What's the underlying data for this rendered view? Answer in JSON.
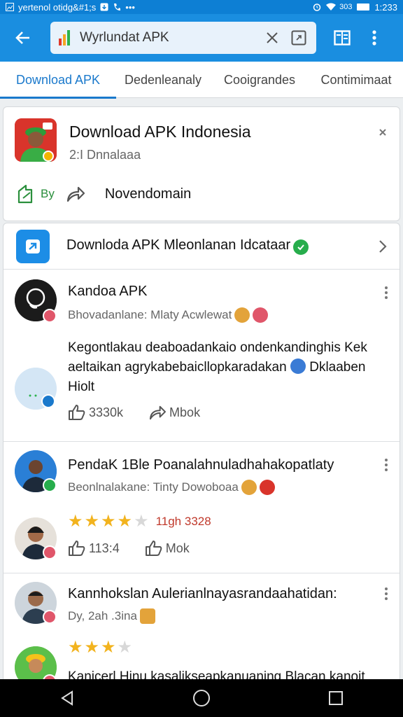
{
  "status_bar": {
    "left_text": "yertenol otidg&#1;s",
    "time": "1:233",
    "battery": "303"
  },
  "app_bar": {
    "search_text": "Wyrlundat APK"
  },
  "tabs": [
    {
      "label": "Download APK",
      "active": true
    },
    {
      "label": "Dedenleanaly",
      "active": false
    },
    {
      "label": "Cooigrandes",
      "active": false
    },
    {
      "label": "Contimimaat",
      "active": false
    }
  ],
  "header_card": {
    "title": "Download APK Indonesia",
    "subtitle": "2:I Dnnalaaa",
    "by_label": "By",
    "domain": "Novendomain"
  },
  "featured": {
    "text": "Downloda APK Mleonlanan Idcataar"
  },
  "posts": [
    {
      "name": "Kandoa APK",
      "meta": "Bhovadanlane: Mlaty Acwlewat",
      "body": "Kegontlakau deaboadankaio ondenkandinghis Kek aeltaikan agrykabebaicllopkaradakan",
      "body_tail": "Dklaaben Hiolt",
      "likes": "3330k",
      "shares": "Mbok"
    },
    {
      "name": "PendaK 1Ble Poanalahnuladhahakopatlaty",
      "meta": "Beonlnalakane: Tinty Dowoboaa",
      "rating": "11gh 3328",
      "likes": "113:4",
      "shares": "Mok"
    },
    {
      "name": "Kannhokslan Aulerianlnayasrandaahatidan:",
      "meta": "Dy, 2ah .3ina",
      "body": "Kanicerl Hinu kasalikseapkanuaning Blacan kanoit"
    }
  ],
  "colors": {
    "app_bar": "#1a8ee0",
    "status_bar": "#0d7fd4",
    "accent": "#1a79cc",
    "verified": "#27ad4c",
    "star": "#f2b31e"
  }
}
